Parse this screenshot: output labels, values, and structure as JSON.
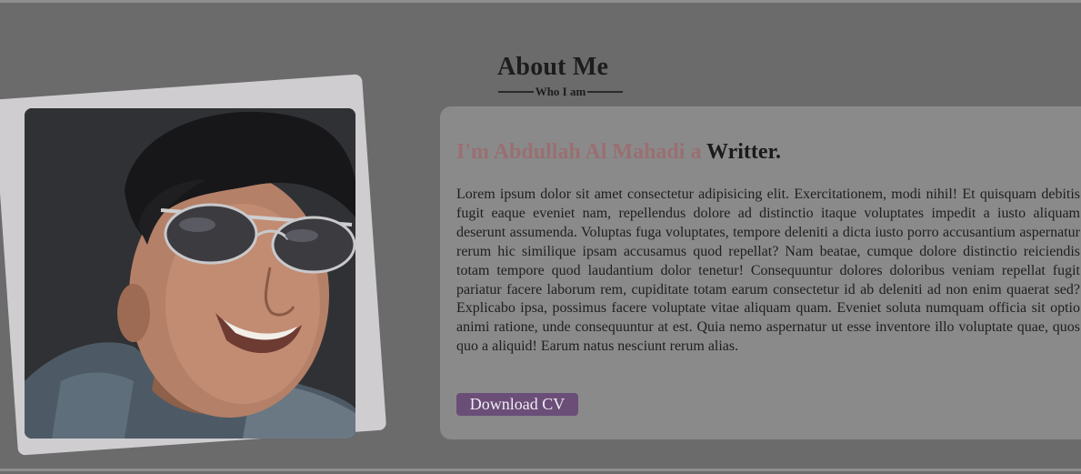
{
  "about": {
    "title": "About Me",
    "subtitle": "Who I am"
  },
  "profile": {
    "headline_prefix": "I'm ",
    "name": "Abdullah Al Mahadi",
    "headline_connector": " a ",
    "role": "Writter.",
    "bio": "Lorem ipsum dolor sit amet consectetur adipisicing elit. Exercitationem, modi nihil! Et quisquam debitis fugit eaque eveniet nam, repellendus dolore ad distinctio itaque voluptates impedit a iusto aliquam deserunt assumenda. Voluptas fuga voluptates, tempore deleniti a dicta iusto porro accusantium aspernatur rerum hic similique ipsam accusamus quod repellat? Nam beatae, cumque dolore distinctio reiciendis totam tempore quod laudantium dolor tenetur! Consequuntur dolores doloribus veniam repellat fugit pariatur facere laborum rem, cupiditate totam earum consectetur id ab deleniti ad non enim quaerat sed? Explicabo ipsa, possimus facere voluptate vitae aliquam quam. Eveniet soluta numquam officia sit optio animi ratione, unde consequuntur at est. Quia nemo aspernatur ut esse inventore illo voluptate quae, quos quo a aliquid! Earum natus nesciunt rerum alias.",
    "cta_label": "Download CV"
  },
  "colors": {
    "page_background": "#6b6b6b",
    "card_background": "#8a8a8a",
    "name_accent": "#9a6f72",
    "button_background": "#6a4e78",
    "photo_frame": "#cfcdd0"
  }
}
